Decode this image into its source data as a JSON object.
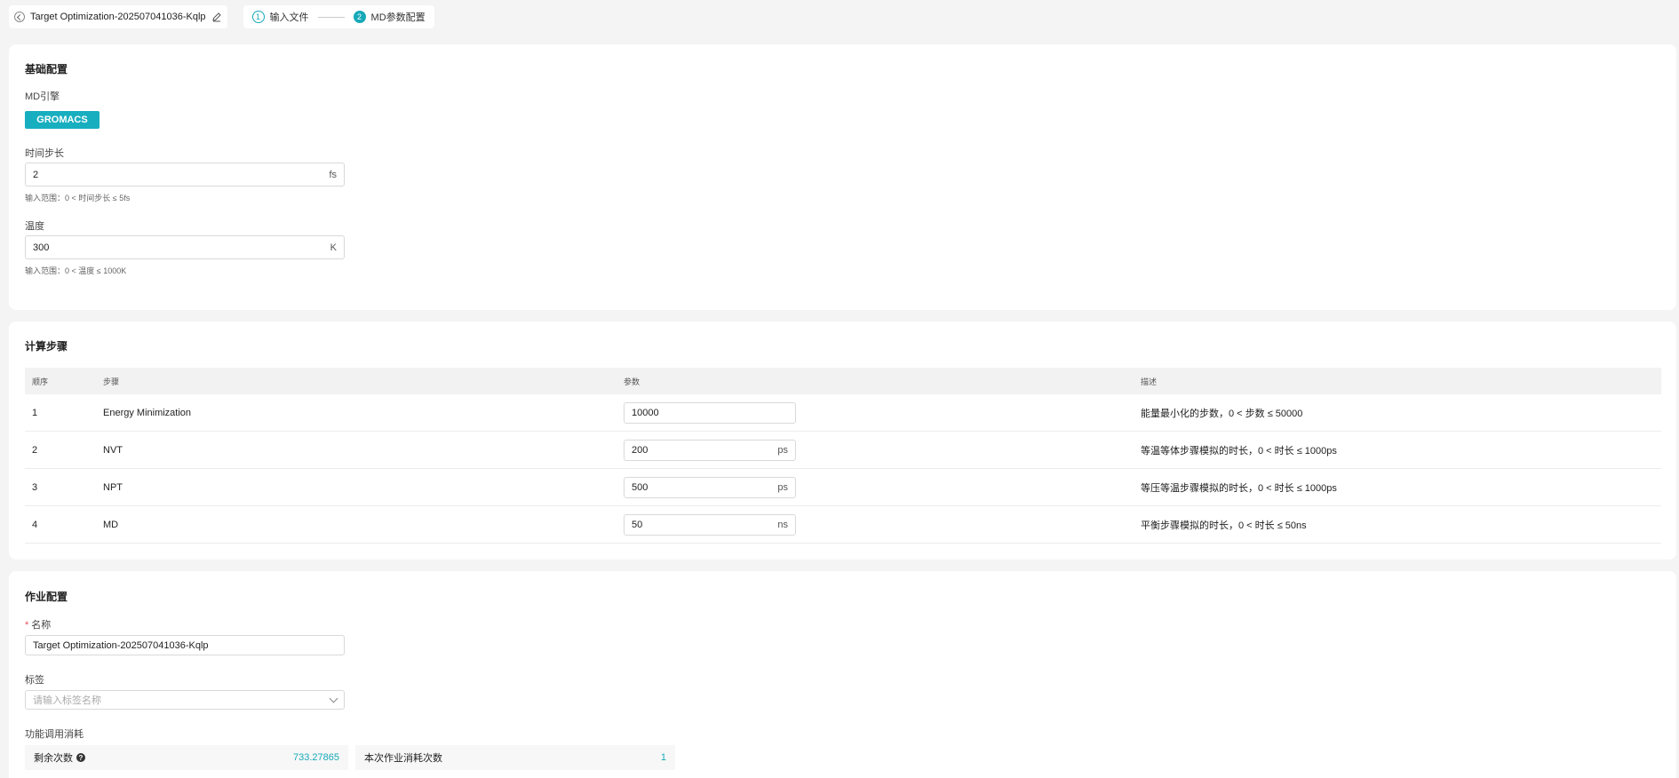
{
  "header": {
    "job_title": "Target Optimization-202507041036-Kqlp",
    "steps": [
      {
        "num": "1",
        "label": "输入文件"
      },
      {
        "num": "2",
        "label": "MD参数配置"
      }
    ]
  },
  "basic": {
    "title": "基础配置",
    "engine_label": "MD引擎",
    "engine_value": "GROMACS",
    "timestep": {
      "label": "时间步长",
      "value": "2",
      "unit": "fs",
      "hint": "输入范围：0 < 时间步长 ≤ 5fs"
    },
    "temperature": {
      "label": "温度",
      "value": "300",
      "unit": "K",
      "hint": "输入范围：0 < 温度 ≤ 1000K"
    }
  },
  "steps_section": {
    "title": "计算步骤",
    "columns": [
      "顺序",
      "步骤",
      "参数",
      "描述"
    ],
    "rows": [
      {
        "order": "1",
        "step": "Energy Minimization",
        "param": "10000",
        "unit": "",
        "desc": "能量最小化的步数，0 < 步数 ≤ 50000"
      },
      {
        "order": "2",
        "step": "NVT",
        "param": "200",
        "unit": "ps",
        "desc": "等温等体步骤模拟的时长，0 < 时长 ≤ 1000ps"
      },
      {
        "order": "3",
        "step": "NPT",
        "param": "500",
        "unit": "ps",
        "desc": "等压等温步骤模拟的时长，0 < 时长 ≤ 1000ps"
      },
      {
        "order": "4",
        "step": "MD",
        "param": "50",
        "unit": "ns",
        "desc": "平衡步骤模拟的时长，0 < 时长 ≤ 50ns"
      }
    ]
  },
  "job": {
    "title": "作业配置",
    "name_label": "名称",
    "name_required": "*",
    "name_value": "Target Optimization-202507041036-Kqlp",
    "tag_label": "标签",
    "tag_placeholder": "请输入标签名称",
    "usage_label": "功能调用消耗",
    "remaining_label": "剩余次数",
    "help_glyph": "?",
    "remaining_value": "733.27865",
    "cost_label": "本次作业消耗次数",
    "cost_value": "1"
  },
  "colors": {
    "accent": "#17aebf"
  }
}
